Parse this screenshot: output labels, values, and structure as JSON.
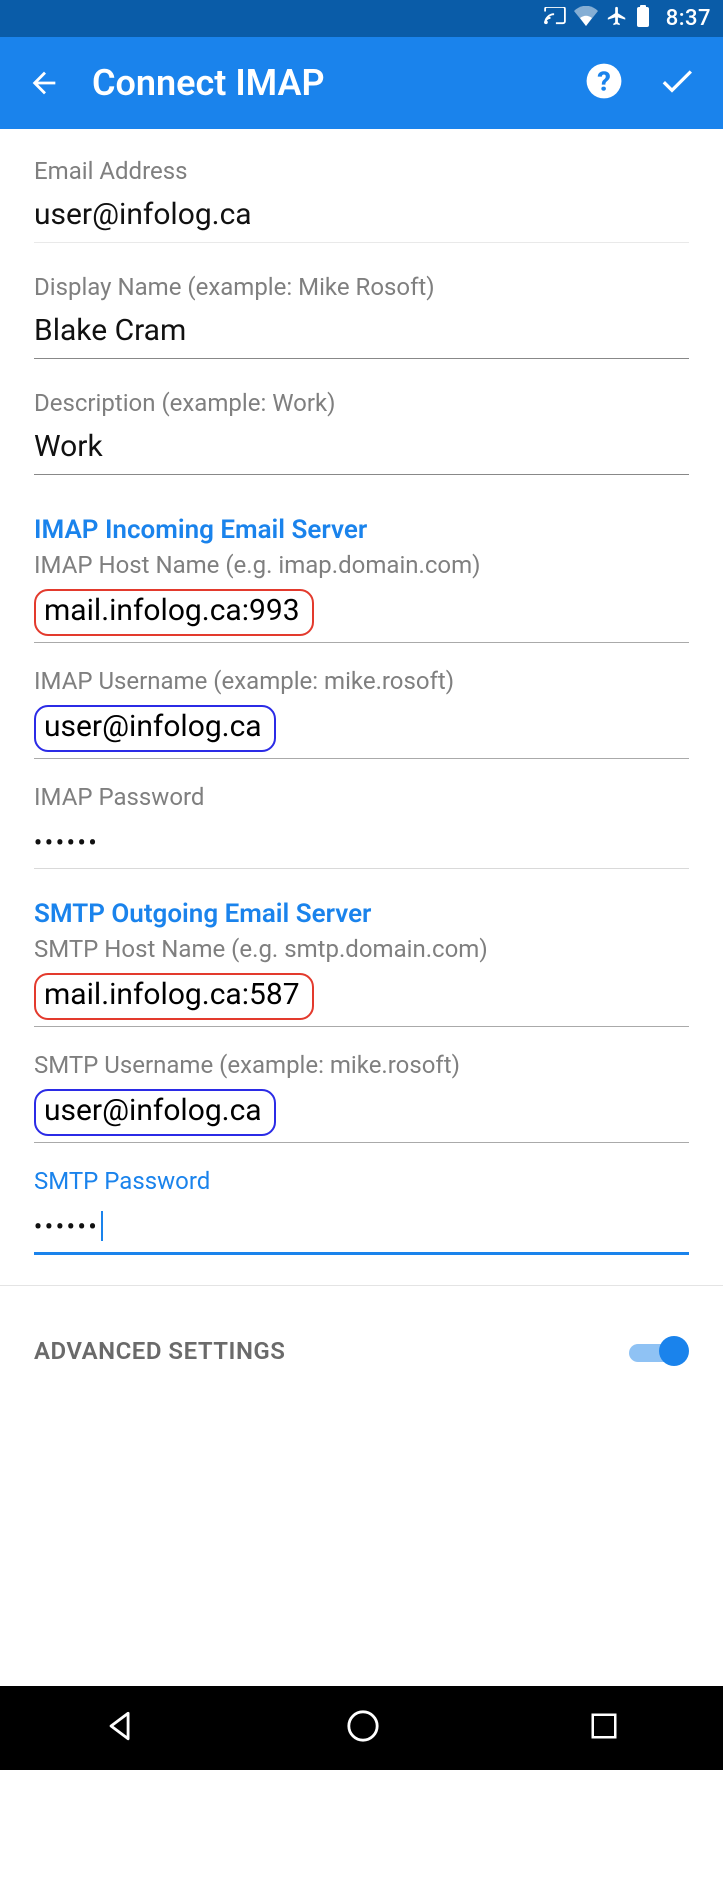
{
  "statusbar": {
    "time": "8:37"
  },
  "appbar": {
    "title": "Connect IMAP"
  },
  "fields": {
    "email": {
      "label": "Email Address",
      "value": "user@infolog.ca"
    },
    "display_name": {
      "label": "Display Name (example: Mike Rosoft)",
      "value": "Blake Cram"
    },
    "description": {
      "label": "Description (example: Work)",
      "value": "Work"
    }
  },
  "imap": {
    "heading": "IMAP Incoming Email Server",
    "host": {
      "label": "IMAP Host Name (e.g. imap.domain.com)",
      "value": "mail.infolog.ca:993"
    },
    "user": {
      "label": "IMAP Username (example: mike.rosoft)",
      "value": "user@infolog.ca"
    },
    "pass": {
      "label": "IMAP Password",
      "value": "••••••"
    }
  },
  "smtp": {
    "heading": "SMTP Outgoing Email Server",
    "host": {
      "label": "SMTP Host Name (e.g. smtp.domain.com)",
      "value": "mail.infolog.ca:587"
    },
    "user": {
      "label": "SMTP Username (example: mike.rosoft)",
      "value": "user@infolog.ca"
    },
    "pass": {
      "label": "SMTP Password",
      "value": "••••••"
    }
  },
  "advanced": {
    "label": "ADVANCED SETTINGS",
    "enabled": true
  }
}
